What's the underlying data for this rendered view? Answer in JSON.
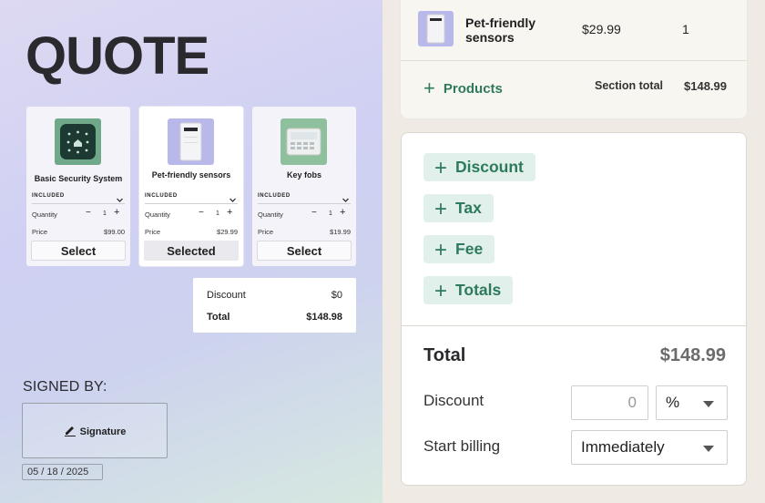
{
  "quote": {
    "title": "QUOTE",
    "cards": [
      {
        "name": "Basic Security System",
        "included": "INCLUDED",
        "quantity_label": "Quantity",
        "quantity": "1",
        "price_label": "Price",
        "price": "$99.00",
        "button": "Select"
      },
      {
        "name": "Pet-friendly sensors",
        "included": "INCLUDED",
        "quantity_label": "Quantity",
        "quantity": "1",
        "price_label": "Price",
        "price": "$29.99",
        "button": "Selected"
      },
      {
        "name": "Key fobs",
        "included": "INCLUDED",
        "quantity_label": "Quantity",
        "quantity": "1",
        "price_label": "Price",
        "price": "$19.99",
        "button": "Select"
      }
    ],
    "summary": {
      "discount_label": "Discount",
      "discount_value": "$0",
      "total_label": "Total",
      "total_value": "$148.98"
    },
    "signed_by": "SIGNED BY:",
    "signature_label": "Signature",
    "date": "05 / 18 / 2025"
  },
  "products": {
    "row": {
      "name": "Pet-friendly sensors",
      "price": "$29.99",
      "qty": "1"
    },
    "add_label": "Products",
    "section_total_label": "Section total",
    "section_total_value": "$148.99"
  },
  "adjustments": {
    "buttons": [
      "Discount",
      "Tax",
      "Fee",
      "Totals"
    ]
  },
  "totals": {
    "total_label": "Total",
    "total_value": "$148.99",
    "discount_label": "Discount",
    "discount_value": "0",
    "discount_unit": "%",
    "start_billing_label": "Start billing",
    "start_billing_value": "Immediately"
  },
  "colors": {
    "accent": "#2e7a5c",
    "accent_bg": "#e1f0ea"
  }
}
